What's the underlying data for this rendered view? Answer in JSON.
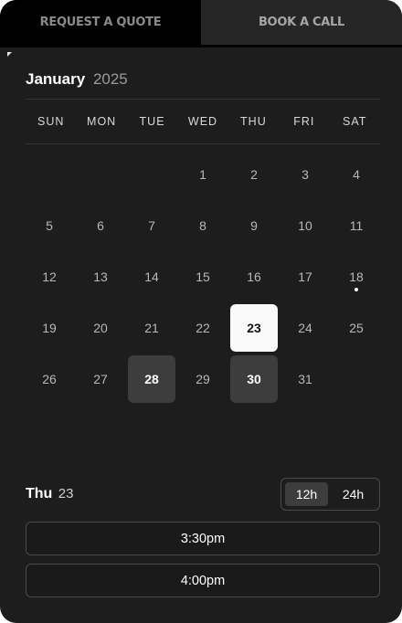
{
  "tabs": {
    "request_quote": "REQUEST A QUOTE",
    "book_call": "BOOK A CALL"
  },
  "calendar": {
    "month": "January",
    "year": "2025",
    "weekdays": [
      "SUN",
      "MON",
      "TUE",
      "WED",
      "THU",
      "FRI",
      "SAT"
    ],
    "leading_blanks": 3,
    "days": [
      "1",
      "2",
      "3",
      "4",
      "5",
      "6",
      "7",
      "8",
      "9",
      "10",
      "11",
      "12",
      "13",
      "14",
      "15",
      "16",
      "17",
      "18",
      "19",
      "20",
      "21",
      "22",
      "23",
      "24",
      "25",
      "26",
      "27",
      "28",
      "29",
      "30",
      "31"
    ],
    "today": "18",
    "selected": "23",
    "available": [
      "28",
      "30"
    ]
  },
  "selection": {
    "weekday": "Thu",
    "day": "23"
  },
  "time_format": {
    "option_12h": "12h",
    "option_24h": "24h",
    "active": "12h"
  },
  "slots": [
    "3:30pm",
    "4:00pm"
  ],
  "colors": {
    "card_bg": "#1d1d1d",
    "selected_bg": "#fafafa",
    "available_bg": "#3d3d3d",
    "border": "#4a4a4a"
  }
}
